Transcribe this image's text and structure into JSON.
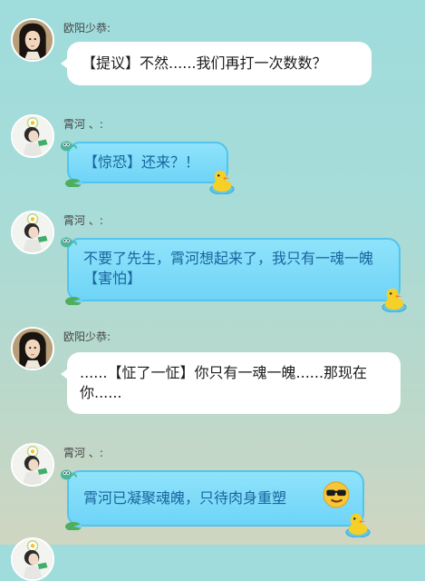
{
  "messages": [
    {
      "sender": "欧阳少恭:",
      "text": "【提议】不然......我们再打一次数数？",
      "style": "white"
    },
    {
      "sender": "霄河 、:",
      "text": "【惊恐】还来？！",
      "style": "blue"
    },
    {
      "sender": "霄河 、:",
      "text": "不要了先生，霄河想起来了，我只有一魂一魄【害怕】",
      "style": "blue"
    },
    {
      "sender": "欧阳少恭:",
      "text": "......【怔了一怔】你只有一魂一魄......那现在你......",
      "style": "white"
    },
    {
      "sender": "霄河 、:",
      "text": "霄河已凝聚魂魄，只待肉身重塑",
      "style": "blue"
    }
  ],
  "icons": {
    "avatar_a": "long-haired-man-avatar",
    "avatar_b": "girl-with-flower-avatar",
    "decor": [
      "tadpole-icon",
      "lily-pad-icon",
      "rubber-duck-icon",
      "sunglasses-emoji-icon"
    ]
  },
  "colors": {
    "bubble_blue": "#6fd4f7",
    "bubble_blue_text": "#19659e",
    "bubble_white": "#ffffff"
  }
}
